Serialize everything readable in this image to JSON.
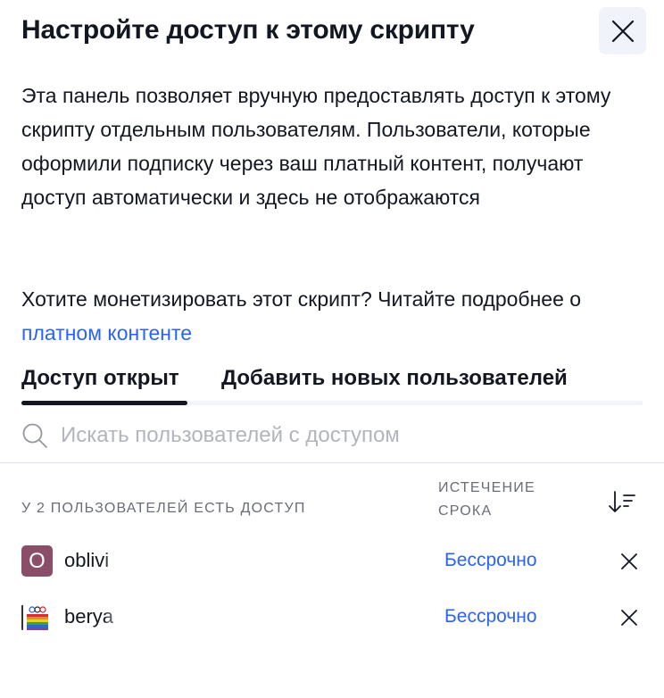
{
  "dialog": {
    "title": "Настройте доступ к этому скрипту",
    "close_icon": "close-icon",
    "description": "Эта панель позволяет вручную предоставлять доступ к этому скрипту отдельным пользователям. Пользователи, которые оформили подписку через ваш платный контент, получают доступ автоматически и здесь не отображаются",
    "monetize_text": "Хотите монетизировать этот скрипт? Читайте подробнее о ",
    "monetize_link": "платном контенте",
    "link_color": "#2962ff"
  },
  "tabs": [
    {
      "label": "Доступ открыт",
      "active": true
    },
    {
      "label": "Добавить новых пользователей",
      "active": false
    }
  ],
  "search": {
    "icon": "search-icon",
    "placeholder": "Искать пользователей с доступом",
    "value": ""
  },
  "list": {
    "count_label": "У 2 ПОЛЬЗОВАТЕЛЕЙ ЕСТЬ ДОСТУП",
    "expiry_header_line1": "ИСТЕЧЕНИЕ",
    "expiry_header_line2": "СРОКА",
    "sort_icon": "sort-icon",
    "users": [
      {
        "avatar_letter": "O",
        "avatar_color": "#8a4e69",
        "name": "oblivi",
        "expiry": "Бессрочно"
      },
      {
        "avatar_letter": "",
        "avatar_color": "",
        "name": "berya",
        "expiry": "Бессрочно"
      }
    ]
  }
}
